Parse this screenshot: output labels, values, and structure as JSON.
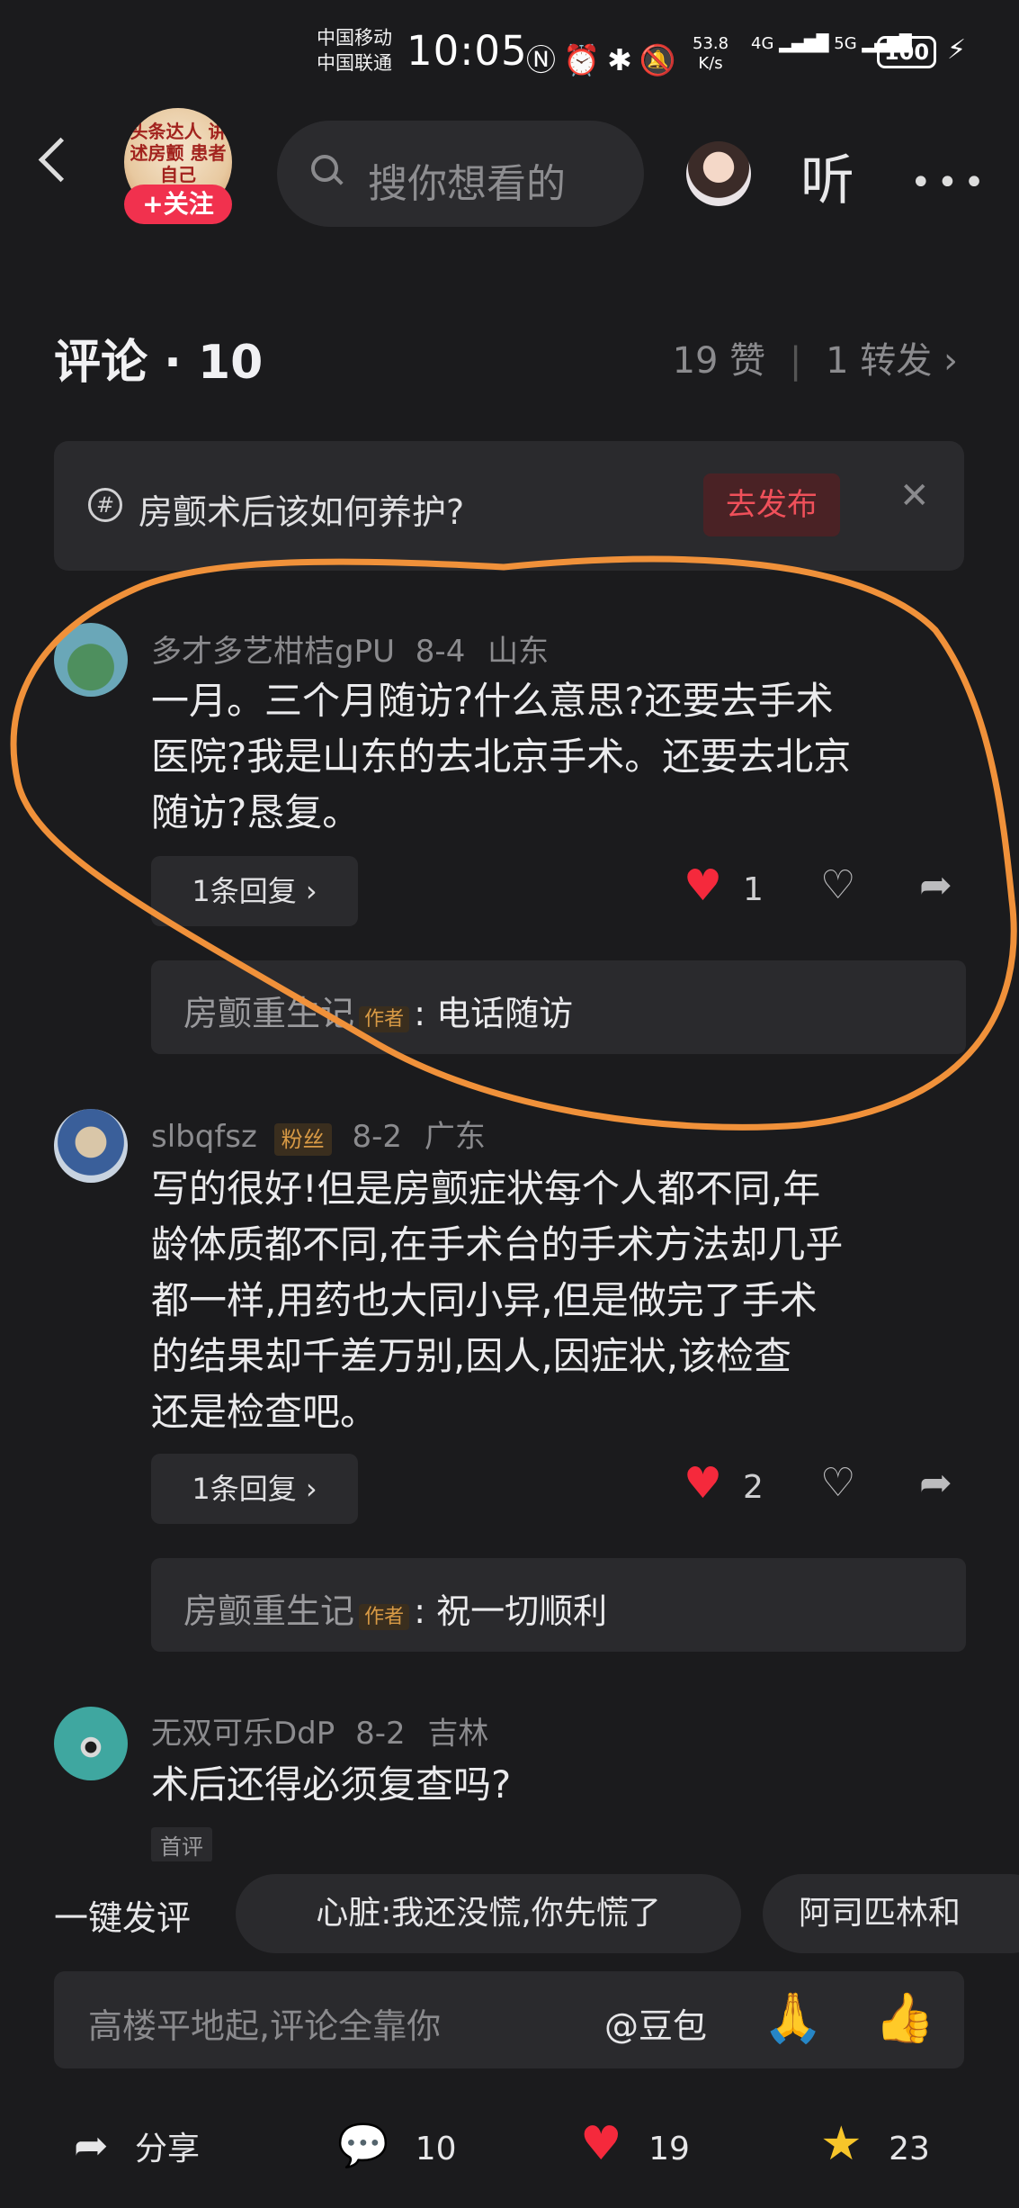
{
  "status_bar": {
    "carrier1": "中国移动",
    "carrier2": "中国联通",
    "time": "10:05",
    "net_speed_value": "53.8",
    "net_speed_unit": "K/s",
    "signal1": "4G",
    "signal2": "5G",
    "battery": "100"
  },
  "header": {
    "follow_label": "+关注",
    "avatar_text": "头条达人 讲述房颤 患者自己",
    "search_placeholder": "搜你想看的",
    "listen_label": "听"
  },
  "comments_header": {
    "title": "评论 · 10",
    "likes": "19 赞",
    "reposts": "1 转发"
  },
  "topic": {
    "text": "房颤术后该如何养护?",
    "publish_label": "去发布"
  },
  "comments": [
    {
      "user": "多才多艺柑桔gPU",
      "date": "8-4",
      "location": "山东",
      "text_lines": [
        "一月。三个月随访?什么意思?还要去手术",
        "医院?我是山东的去北京手术。还要去北京",
        "随访?恳复。"
      ],
      "reply_label": "1条回复",
      "likes": "1",
      "author_reply": {
        "name": "房颤重生记",
        "tag": "作者",
        "text": ": 电话随访"
      }
    },
    {
      "user": "slbqfsz",
      "badge": "粉丝",
      "date": "8-2",
      "location": "广东",
      "text_lines": [
        "写的很好!但是房颤症状每个人都不同,年",
        "龄体质都不同,在手术台的手术方法却几乎",
        "都一样,用药也大同小异,但是做完了手术",
        "的结果却千差万别,因人,因症状,该检查",
        "还是检查吧。"
      ],
      "reply_label": "1条回复",
      "likes": "2",
      "author_reply": {
        "name": "房颤重生记",
        "tag": "作者",
        "text": ": 祝一切顺利"
      }
    },
    {
      "user": "无双可乐DdP",
      "date": "8-2",
      "location": "吉林",
      "text_lines": [
        "术后还得必须复查吗?"
      ],
      "badge_bottom": "首评"
    }
  ],
  "bottom": {
    "quick_label": "一键发评",
    "chip1": "心脏:我还没慌,你先慌了",
    "chip2": "阿司匹林和",
    "input_placeholder": "高楼平地起,评论全靠你",
    "doubao": "@豆包",
    "share_label": "分享",
    "comment_count": "10",
    "like_count": "19",
    "star_count": "23"
  },
  "colors": {
    "background": "#1b1b1d",
    "accent_red": "#f5293c",
    "annotation_orange": "#f0913a",
    "star_yellow": "#f7c52a"
  }
}
